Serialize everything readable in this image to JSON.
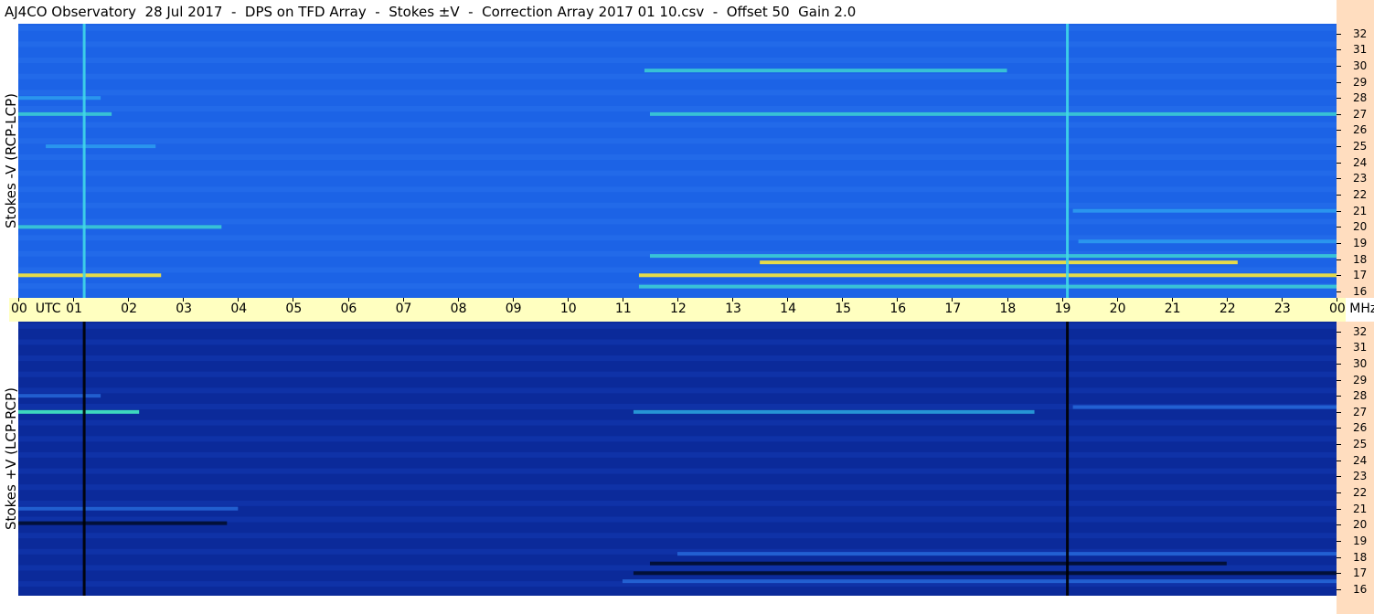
{
  "title": "AJ4CO Observatory  28 Jul 2017  -  DPS on TFD Array  -  Stokes ±V  -  Correction Array 2017 01 10.csv  -  Offset 50  Gain 2.0",
  "colors": {
    "top_panel_bg": "#1c63e6",
    "bottom_panel_bg": "#0b2a9a",
    "time_axis_bg": "#ffffc0",
    "freq_axis_bg": "#ffddbf"
  },
  "chart_data": [
    {
      "type": "heatmap",
      "title": "Stokes -V (RCP-LCP)",
      "ylabel": "Stokes -V (RCP-LCP)",
      "xlabel": "UTC",
      "x_ticks": [
        "00",
        "01",
        "02",
        "03",
        "04",
        "05",
        "06",
        "07",
        "08",
        "09",
        "10",
        "11",
        "12",
        "13",
        "14",
        "15",
        "16",
        "17",
        "18",
        "19",
        "20",
        "21",
        "22",
        "23",
        "00"
      ],
      "x_range_hours": [
        0,
        24
      ],
      "y_unit": "MHz",
      "y_range_mhz": [
        15.6,
        32.6
      ],
      "y_ticks": [
        16,
        17,
        18,
        19,
        20,
        21,
        22,
        23,
        24,
        25,
        26,
        27,
        28,
        29,
        30,
        31,
        32
      ],
      "vertical_features_utc": [
        1.2,
        19.1
      ],
      "bands": [
        {
          "mhz": 17.0,
          "from_utc": 0.0,
          "to_utc": 2.6,
          "level": "high"
        },
        {
          "mhz": 17.0,
          "from_utc": 11.3,
          "to_utc": 24.0,
          "level": "high"
        },
        {
          "mhz": 17.8,
          "from_utc": 13.5,
          "to_utc": 22.2,
          "level": "high"
        },
        {
          "mhz": 18.2,
          "from_utc": 11.5,
          "to_utc": 24.0,
          "level": "medium"
        },
        {
          "mhz": 16.3,
          "from_utc": 11.3,
          "to_utc": 24.0,
          "level": "medium"
        },
        {
          "mhz": 20.0,
          "from_utc": 0.0,
          "to_utc": 3.7,
          "level": "medium"
        },
        {
          "mhz": 27.0,
          "from_utc": 0.0,
          "to_utc": 1.7,
          "level": "medium"
        },
        {
          "mhz": 27.0,
          "from_utc": 11.5,
          "to_utc": 24.0,
          "level": "medium"
        },
        {
          "mhz": 29.7,
          "from_utc": 11.4,
          "to_utc": 18.0,
          "level": "medium"
        },
        {
          "mhz": 28.0,
          "from_utc": 0.0,
          "to_utc": 1.5,
          "level": "low"
        },
        {
          "mhz": 21.0,
          "from_utc": 19.2,
          "to_utc": 24.0,
          "level": "low"
        },
        {
          "mhz": 19.1,
          "from_utc": 19.3,
          "to_utc": 24.0,
          "level": "low"
        },
        {
          "mhz": 25.0,
          "from_utc": 0.5,
          "to_utc": 2.5,
          "level": "low"
        }
      ]
    },
    {
      "type": "heatmap",
      "title": "Stokes +V (LCP-RCP)",
      "ylabel": "Stokes +V (LCP-RCP)",
      "xlabel": "UTC",
      "x_ticks": [
        "00",
        "01",
        "02",
        "03",
        "04",
        "05",
        "06",
        "07",
        "08",
        "09",
        "10",
        "11",
        "12",
        "13",
        "14",
        "15",
        "16",
        "17",
        "18",
        "19",
        "20",
        "21",
        "22",
        "23",
        "00"
      ],
      "x_range_hours": [
        0,
        24
      ],
      "y_unit": "MHz",
      "y_range_mhz": [
        15.6,
        32.6
      ],
      "y_ticks": [
        16,
        17,
        18,
        19,
        20,
        21,
        22,
        23,
        24,
        25,
        26,
        27,
        28,
        29,
        30,
        31,
        32
      ],
      "vertical_features_utc": [
        1.2,
        19.1
      ],
      "bands": [
        {
          "mhz": 27.0,
          "from_utc": 0.0,
          "to_utc": 2.2,
          "level": "high"
        },
        {
          "mhz": 27.0,
          "from_utc": 11.2,
          "to_utc": 18.5,
          "level": "medium"
        },
        {
          "mhz": 27.3,
          "from_utc": 19.2,
          "to_utc": 24.0,
          "level": "low"
        },
        {
          "mhz": 28.0,
          "from_utc": 0.0,
          "to_utc": 1.5,
          "level": "low"
        },
        {
          "mhz": 17.0,
          "from_utc": 11.2,
          "to_utc": 24.0,
          "level": "dark"
        },
        {
          "mhz": 17.6,
          "from_utc": 11.5,
          "to_utc": 22.0,
          "level": "dark"
        },
        {
          "mhz": 18.2,
          "from_utc": 12.0,
          "to_utc": 24.0,
          "level": "low"
        },
        {
          "mhz": 21.0,
          "from_utc": 0.0,
          "to_utc": 4.0,
          "level": "low"
        },
        {
          "mhz": 20.1,
          "from_utc": 0.0,
          "to_utc": 3.8,
          "level": "dark"
        },
        {
          "mhz": 16.5,
          "from_utc": 11.0,
          "to_utc": 24.0,
          "level": "low"
        }
      ]
    }
  ]
}
